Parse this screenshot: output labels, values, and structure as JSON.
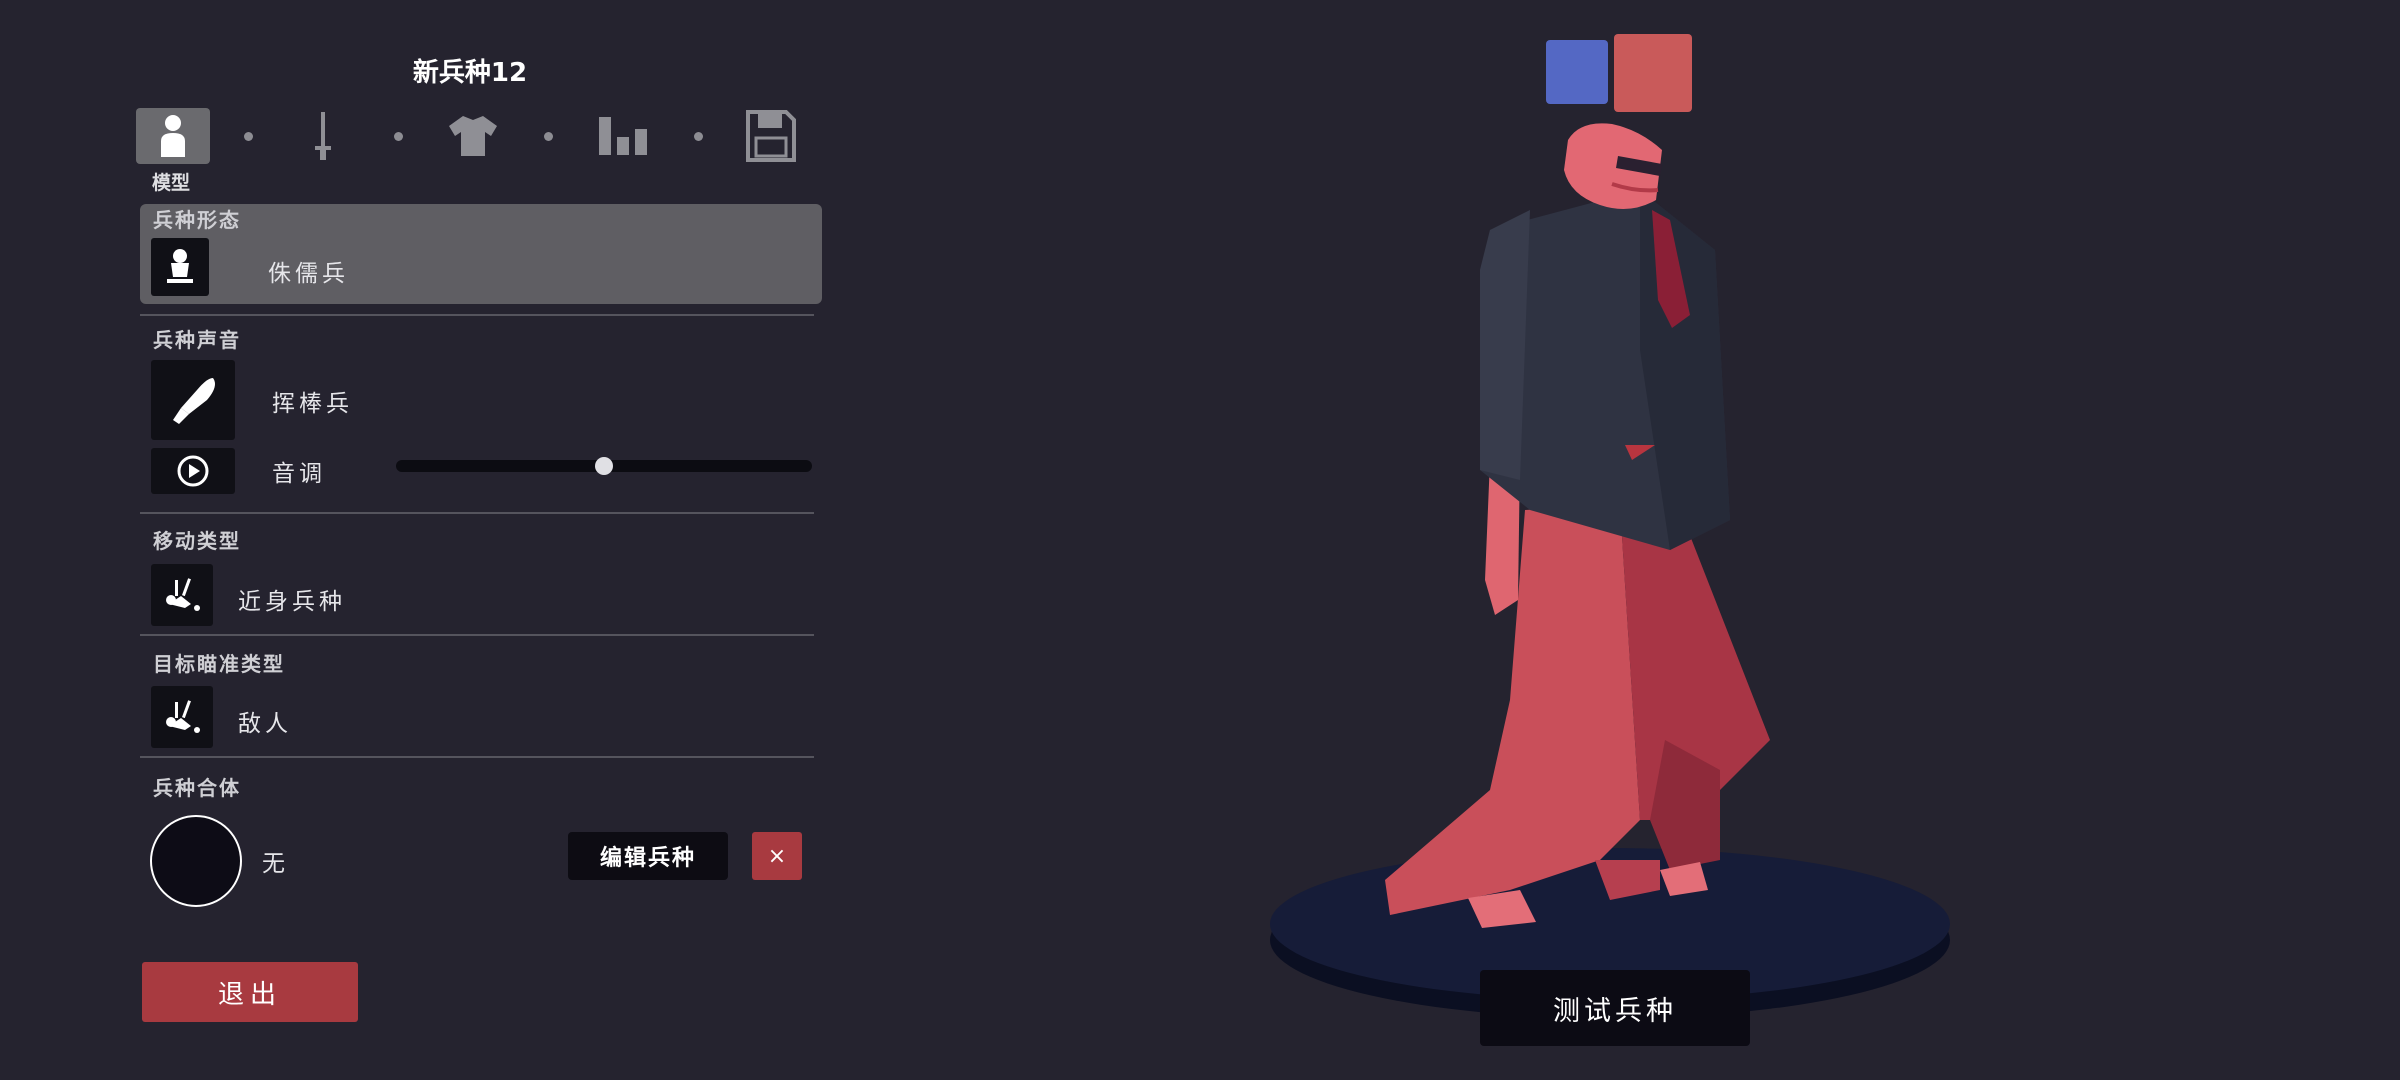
{
  "header": {
    "title": "新兵种12"
  },
  "tabs": {
    "items": [
      {
        "name": "model",
        "icon": "person-icon"
      },
      {
        "name": "weapon",
        "icon": "sword-icon"
      },
      {
        "name": "clothing",
        "icon": "shirt-icon"
      },
      {
        "name": "stats",
        "icon": "bar-chart-icon"
      },
      {
        "name": "save",
        "icon": "save-icon"
      }
    ],
    "active_caption": "模型"
  },
  "unit_form": {
    "label": "兵种形态",
    "value": "侏儒兵",
    "icon": "dwarf-icon"
  },
  "unit_voice": {
    "label": "兵种声音",
    "value": "挥棒兵",
    "icon": "club-icon",
    "pitch_label": "音调",
    "pitch_level": 0.5
  },
  "movement": {
    "label": "移动类型",
    "value": "近身兵种",
    "icon": "melee-icon"
  },
  "targeting": {
    "label": "目标瞄准类型",
    "value": "敌人",
    "icon": "target-icon"
  },
  "merge": {
    "label": "兵种合体",
    "value": "无",
    "edit_label": "编辑兵种",
    "remove_label": "×"
  },
  "exit_label": "退出",
  "team_colors": {
    "blue": "#5468c4",
    "red": "#c95a5a"
  },
  "test_label": "测试兵种"
}
